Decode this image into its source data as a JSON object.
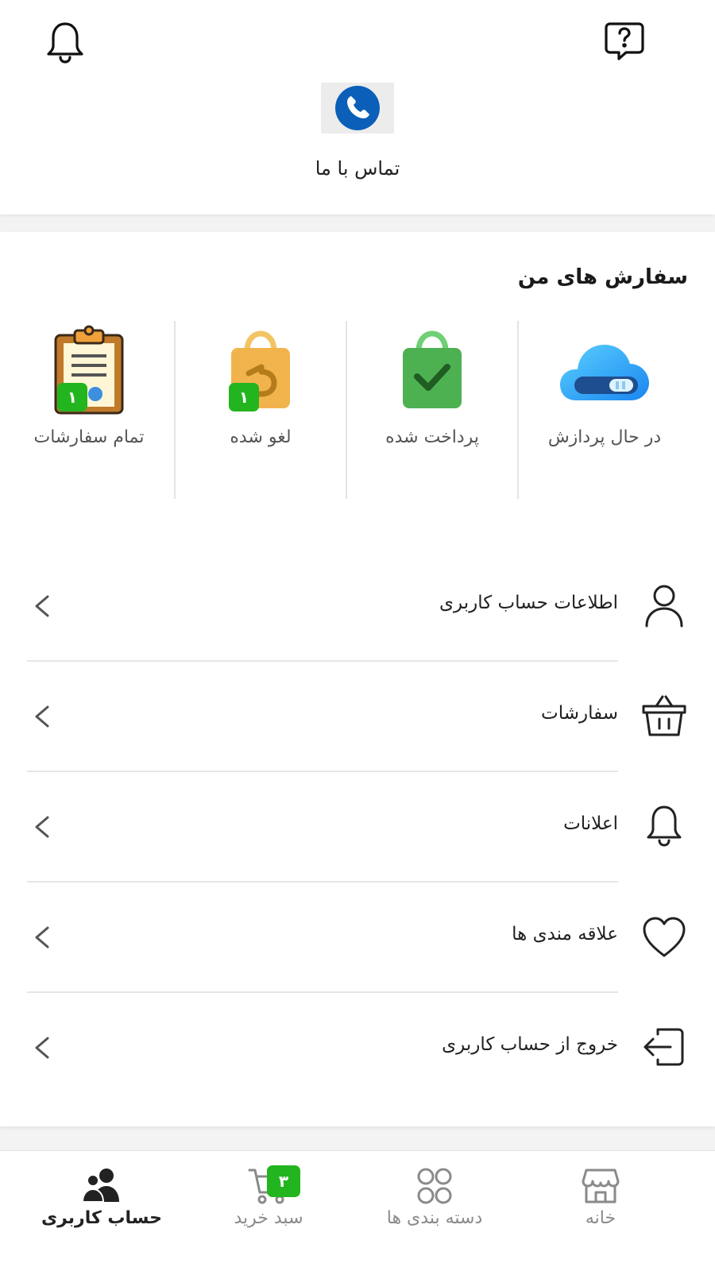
{
  "header": {
    "contact_label": "تماس با ما"
  },
  "orders": {
    "title": "سفارش های من",
    "items": [
      {
        "label": "در حال پردازش",
        "icon": "cloud-toggle-icon"
      },
      {
        "label": "پرداخت شده",
        "icon": "paid-bag-icon"
      },
      {
        "label": "لغو شده",
        "icon": "cancelled-bag-icon",
        "count": "۱"
      },
      {
        "label": "تمام سفارشات",
        "icon": "clipboard-icon",
        "count": "۱"
      }
    ]
  },
  "menu": {
    "items": [
      {
        "label": "اطلاعات حساب کاربری",
        "icon": "user-icon"
      },
      {
        "label": "سفارشات",
        "icon": "basket-icon"
      },
      {
        "label": "اعلانات",
        "icon": "bell-icon"
      },
      {
        "label": "علاقه مندی ها",
        "icon": "heart-icon"
      },
      {
        "label": "خروج از حساب کاربری",
        "icon": "logout-icon"
      }
    ]
  },
  "bottom_nav": {
    "items": [
      {
        "label": "خانه",
        "icon": "store-icon"
      },
      {
        "label": "دسته بندی ها",
        "icon": "categories-icon"
      },
      {
        "label": "سبد خرید",
        "icon": "cart-icon",
        "badge": "۳"
      },
      {
        "label": "حساب کاربری",
        "icon": "users-icon",
        "active": true
      }
    ]
  },
  "colors": {
    "accent_green": "#22b51f",
    "phone_blue": "#0b5fb8",
    "background": "#f3f3f3"
  }
}
